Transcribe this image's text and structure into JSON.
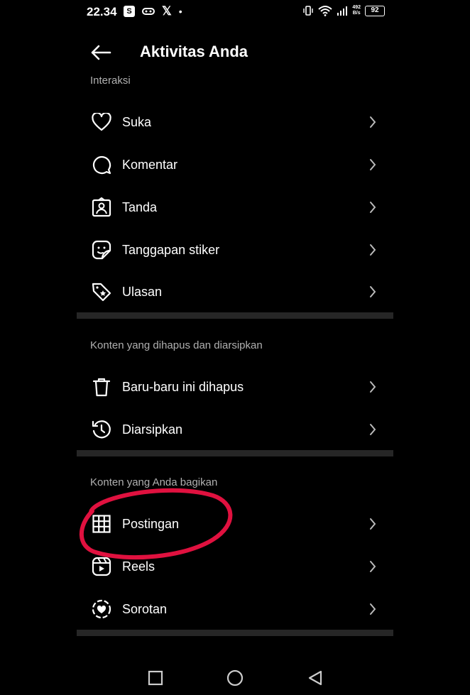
{
  "status": {
    "time": "22.34",
    "app_badge": "S",
    "x_glyph": "𝕏",
    "dot": "•",
    "speed_top": "492",
    "speed_bottom": "B/s",
    "battery": "92"
  },
  "header": {
    "title": "Aktivitas Anda"
  },
  "sections": {
    "interaksi": {
      "title": "Interaksi",
      "items": [
        {
          "label": "Suka",
          "icon": "heart-icon"
        },
        {
          "label": "Komentar",
          "icon": "comment-icon"
        },
        {
          "label": "Tanda",
          "icon": "tag-person-icon"
        },
        {
          "label": "Tanggapan stiker",
          "icon": "sticker-icon"
        },
        {
          "label": "Ulasan",
          "icon": "review-tag-icon"
        }
      ]
    },
    "dihapus": {
      "title": "Konten yang dihapus dan diarsipkan",
      "items": [
        {
          "label": "Baru-baru ini dihapus",
          "icon": "trash-icon"
        },
        {
          "label": "Diarsipkan",
          "icon": "archive-history-icon"
        }
      ]
    },
    "bagikan": {
      "title": "Konten yang Anda bagikan",
      "items": [
        {
          "label": "Postingan",
          "icon": "grid-icon"
        },
        {
          "label": "Reels",
          "icon": "reels-icon"
        },
        {
          "label": "Sorotan",
          "icon": "highlight-icon"
        }
      ]
    }
  },
  "accent": {
    "annotation": "#e0113f"
  }
}
